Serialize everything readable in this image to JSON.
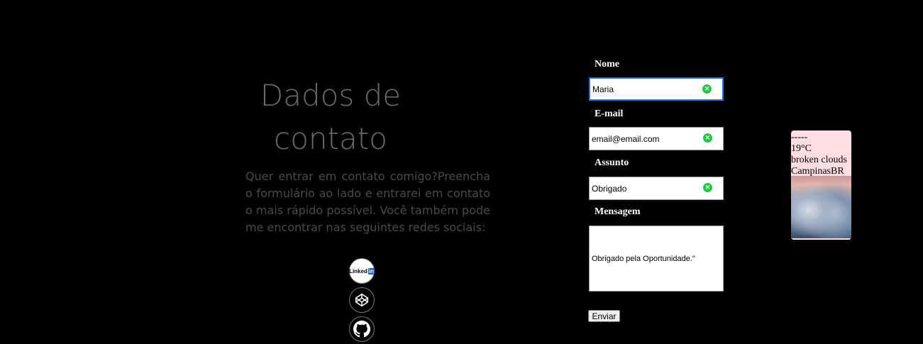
{
  "contact": {
    "title_line1": "Dados de",
    "title_line2": "contato",
    "description": "Quer entrar em contato comigo?Preencha o formulário ao lado e entrarei em contato o mais rápido possível. Você também pode me encontrar nas seguintes redes sociais:",
    "social": [
      {
        "name": "LinkedIn",
        "icon": "linkedin-icon"
      },
      {
        "name": "CodePen",
        "icon": "codepen-icon"
      },
      {
        "name": "GitHub",
        "icon": "github-icon"
      }
    ],
    "linkedin_text": "Linked",
    "linkedin_in": "in"
  },
  "form": {
    "nome_label": "Nome",
    "nome_value": "Maria",
    "email_label": "E-mail",
    "email_value": "email@email.com",
    "assunto_label": "Assunto",
    "assunto_value": "Obrigado",
    "mensagem_label": "Mensagem",
    "mensagem_value": "Obrigado pela Oportunidade.\"",
    "submit_label": "Enviar",
    "valid_icon": "check-circle-icon",
    "valid_color": "#1ec93c",
    "focus_color": "#1a73e8"
  },
  "weather": {
    "line1": "-----",
    "temp": "19°C",
    "condition": "broken clouds",
    "location": "CampinasBR",
    "image_icon": "clouds-image"
  }
}
